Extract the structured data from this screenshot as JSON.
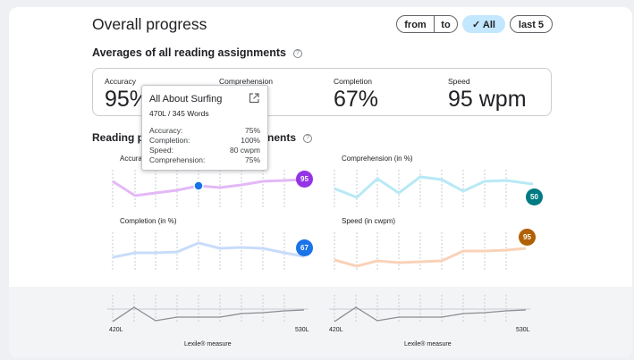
{
  "header": {
    "title": "Overall progress",
    "filters": {
      "from": "from",
      "to": "to",
      "all": "All",
      "last5": "last 5"
    }
  },
  "averages": {
    "title": "Averages of all reading assignments",
    "help_icon": "help-circle-icon",
    "items": [
      {
        "label": "Accuracy",
        "value": "95%"
      },
      {
        "label": "Comprehension",
        "value": ""
      },
      {
        "label": "Completion",
        "value": "67%"
      },
      {
        "label": "Speed",
        "value": "95 wpm"
      }
    ]
  },
  "progress": {
    "title_left": "Reading pr",
    "title_right": "nents",
    "help_icon": "help-circle-icon",
    "charts": {
      "accuracy": {
        "label": "Accura",
        "end_badge": "95",
        "color": "#9334e6",
        "line": "#e3b8f7"
      },
      "comprehension": {
        "label": "Comprehension (in %)",
        "end_badge": "50",
        "color": "#007b83",
        "line": "#b8e9f5"
      },
      "completion": {
        "label": "Completion (in %)",
        "end_badge": "67",
        "color": "#1a73e8",
        "line": "#c8dcfa"
      },
      "speed": {
        "label": "Speed (in cwpm)",
        "end_badge": "95",
        "color": "#b06000",
        "line": "#f9d2b8"
      }
    }
  },
  "lexile": {
    "left": {
      "min": "420L",
      "max": "530L",
      "axis": "Lexile® measure"
    },
    "right": {
      "min": "420L",
      "max": "530L",
      "axis": "Lexile® measure"
    }
  },
  "tooltip": {
    "title": "All About Surfing",
    "subtitle": "470L / 345 Words",
    "icon": "open-in-new-icon",
    "rows": [
      {
        "label": "Accuracy:",
        "value": "75%"
      },
      {
        "label": "Completion:",
        "value": "100%"
      },
      {
        "label": "Speed:",
        "value": "80 cwpm"
      },
      {
        "label": "Comprehension:",
        "value": "75%"
      }
    ]
  }
}
